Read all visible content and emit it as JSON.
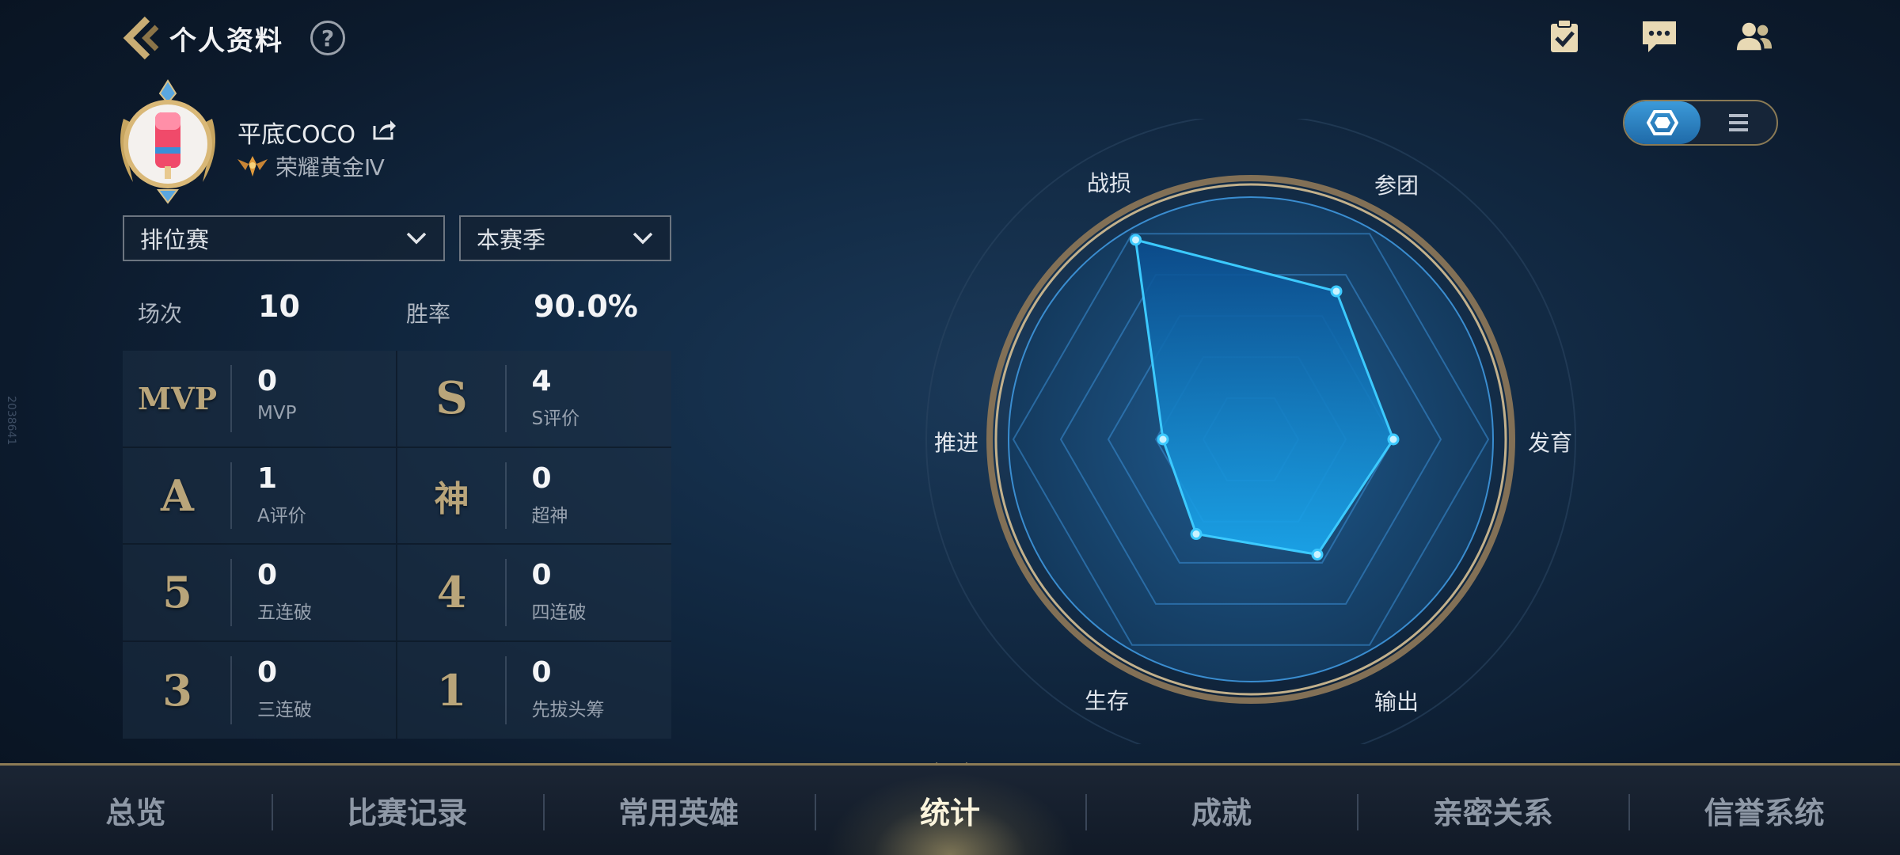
{
  "header": {
    "title": "个人资料",
    "help": "?"
  },
  "watermark": "2038641",
  "profile": {
    "name": "平底COCO",
    "rank": "荣耀黄金Ⅳ"
  },
  "filters": {
    "mode": "排位赛",
    "season": "本赛季"
  },
  "summary": {
    "matches_label": "场次",
    "matches_value": "10",
    "winrate_label": "胜率",
    "winrate_value": "90.0%"
  },
  "stats": [
    {
      "icon_text": "MVP",
      "value": "0",
      "label": "MVP"
    },
    {
      "icon_text": "S",
      "value": "4",
      "label": "S评价"
    },
    {
      "icon_text": "A",
      "value": "1",
      "label": "A评价"
    },
    {
      "icon_text": "神",
      "value": "0",
      "label": "超神"
    },
    {
      "icon_text": "5",
      "value": "0",
      "label": "五连破"
    },
    {
      "icon_text": "4",
      "value": "0",
      "label": "四连破"
    },
    {
      "icon_text": "3",
      "value": "0",
      "label": "三连破"
    },
    {
      "icon_text": "1",
      "value": "0",
      "label": "先拔头筹"
    }
  ],
  "radar": {
    "labels": {
      "top_left": "战损",
      "top_right": "参团",
      "right": "发育",
      "bottom_right": "输出",
      "bottom_left": "生存",
      "left": "推进"
    },
    "values": {
      "战损": 0.97,
      "参团": 0.72,
      "发育": 0.6,
      "输出": 0.56,
      "生存": 0.46,
      "推进": 0.37
    }
  },
  "nav": {
    "tabs": [
      "总览",
      "比赛记录",
      "常用英雄",
      "统计",
      "成就",
      "亲密关系",
      "信誉系统"
    ],
    "active_index": 3
  },
  "colors": {
    "accent_gold": "#b9a57a",
    "radar_blue": "#35c6ff"
  }
}
